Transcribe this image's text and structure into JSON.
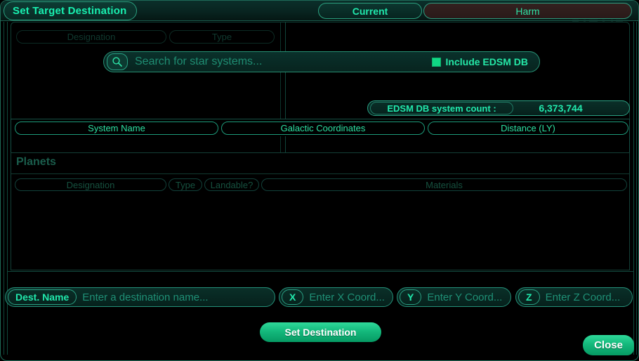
{
  "window": {
    "title": "Set Target Destination"
  },
  "tabs": [
    {
      "id": "current",
      "label": "Current",
      "active": true
    },
    {
      "id": "harm",
      "label": "Harm",
      "active": false
    }
  ],
  "background_panel": {
    "columns": [
      "Designation",
      "Type"
    ]
  },
  "search": {
    "icon": "search-icon",
    "value": "",
    "placeholder": "Search for star systems...",
    "edsm_toggle": {
      "label": "Include EDSM DB",
      "checked": true,
      "check_color": "#10d884"
    }
  },
  "edsm_count": {
    "label": "EDSM DB system count :",
    "value": "6,373,744"
  },
  "systems_table": {
    "columns": [
      "System Name",
      "Galactic Coordinates",
      "Distance (LY)"
    ],
    "rows": []
  },
  "planets": {
    "title": "Planets",
    "columns": [
      "Designation",
      "Type",
      "Landable?",
      "Materials"
    ],
    "rows": []
  },
  "destination_form": {
    "name": {
      "tag": "Dest. Name",
      "value": "",
      "placeholder": "Enter a destination name..."
    },
    "x": {
      "tag": "X",
      "value": "",
      "placeholder": "Enter X Coord..."
    },
    "y": {
      "tag": "Y",
      "value": "",
      "placeholder": "Enter Y Coord..."
    },
    "z": {
      "tag": "Z",
      "value": "",
      "placeholder": "Enter Z Coord..."
    }
  },
  "actions": {
    "set_destination": "Set Destination",
    "close": "Close"
  },
  "theme": {
    "accent": "#21e8ac",
    "bright": "#19f0b0",
    "dim": "#1f7e66",
    "button_green": "#14b97c",
    "harm_tab_bg": "#33211f",
    "background": "#000000"
  }
}
